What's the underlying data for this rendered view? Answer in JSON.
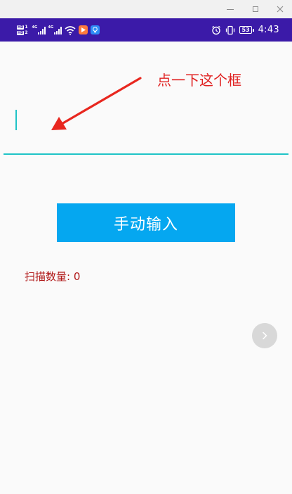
{
  "window": {
    "controls": [
      "minimize",
      "maximize",
      "close"
    ]
  },
  "status_bar": {
    "hd_labels": [
      "HD",
      "1",
      "HD",
      "2"
    ],
    "network_labels": [
      "4G",
      "4G"
    ],
    "battery": "53",
    "time": "4:43"
  },
  "annotation": {
    "text": "点一下这个框",
    "color": "#e02020"
  },
  "input": {
    "value": "",
    "underline_color": "#1fc3c6"
  },
  "manual_button": {
    "label": "手动输入",
    "color": "#05a7f0"
  },
  "scan": {
    "label": "扫描数量:",
    "count": "0",
    "color": "#b01717"
  },
  "colors": {
    "status_bar": "#3b1aa8"
  },
  "icons": [
    "alarm-icon",
    "vibrate-icon",
    "wifi-icon",
    "signal-icon",
    "chevron-right-icon"
  ]
}
